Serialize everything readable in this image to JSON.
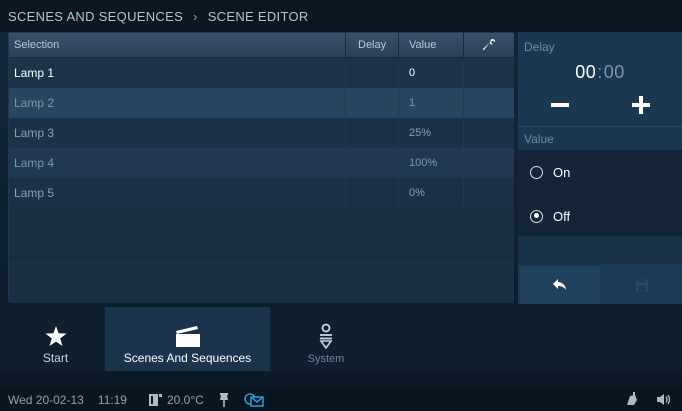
{
  "breadcrumb": {
    "parent": "SCENES AND SEQUENCES",
    "separator": "›",
    "current": "SCENE EDITOR"
  },
  "table": {
    "headers": {
      "selection": "Selection",
      "delay": "Delay",
      "value": "Value",
      "tool_icon": "wrench-icon"
    },
    "rows": [
      {
        "name": "Lamp 1",
        "delay": "",
        "value": "0"
      },
      {
        "name": "Lamp 2",
        "delay": "",
        "value": "1"
      },
      {
        "name": "Lamp 3",
        "delay": "",
        "value": "25%"
      },
      {
        "name": "Lamp 4",
        "delay": "",
        "value": "100%"
      },
      {
        "name": "Lamp 5",
        "delay": "",
        "value": "0%"
      }
    ]
  },
  "side_panel": {
    "delay_label": "Delay",
    "delay_minutes": "00",
    "delay_colon": ":",
    "delay_seconds": "00",
    "value_label": "Value",
    "options": [
      {
        "label": "On",
        "checked": false
      },
      {
        "label": "Off",
        "checked": true
      }
    ],
    "back_icon": "back-arrow-icon",
    "save_icon": "save-icon"
  },
  "nav": {
    "tabs": [
      {
        "label": "Start",
        "icon": "star-icon"
      },
      {
        "label": "Scenes And Sequences",
        "icon": "clapperboard-icon",
        "active": true
      },
      {
        "label": "System",
        "icon": "system-icon"
      }
    ]
  },
  "status": {
    "date": "Wed 20-02-13",
    "time": "11:19",
    "temperature": "20.0°C"
  },
  "colors": {
    "accent": "#2e9bd6",
    "background": "#0f2030",
    "active_tab": "#1b344b"
  }
}
